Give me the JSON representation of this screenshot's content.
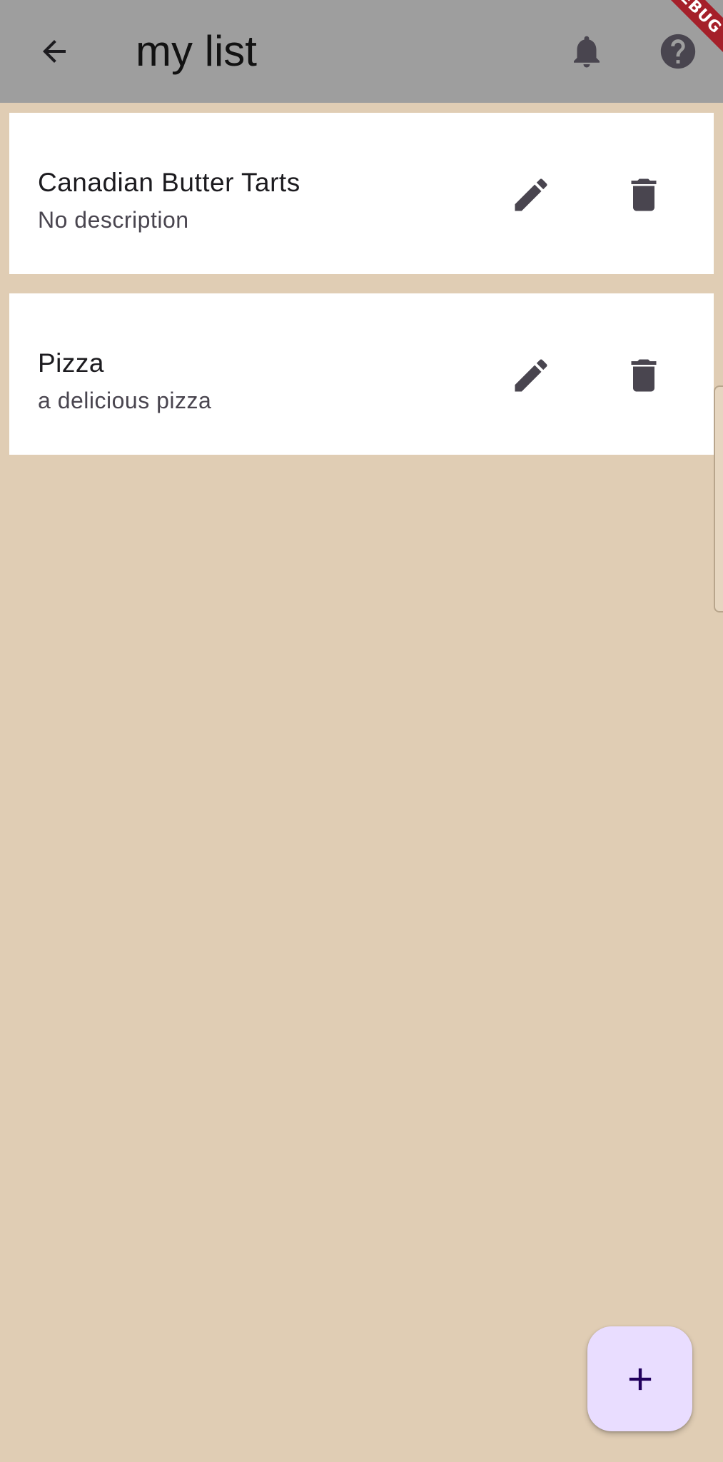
{
  "app_bar": {
    "title": "my list",
    "back_icon": "arrow-back-icon",
    "notification_icon": "bell-icon",
    "help_icon": "help-circle-icon",
    "background_color": "#9e9e9e"
  },
  "debug_banner": {
    "label": "DEBUG",
    "color": "#a5202a"
  },
  "items": [
    {
      "title": "Canadian Butter Tarts",
      "description": "No description",
      "edit_icon": "pencil-icon",
      "delete_icon": "trash-icon"
    },
    {
      "title": "Pizza",
      "description": "a delicious pizza",
      "edit_icon": "pencil-icon",
      "delete_icon": "trash-icon"
    }
  ],
  "fab": {
    "icon": "plus-icon",
    "background_color": "#e9ddff",
    "icon_color": "#21005d"
  },
  "colors": {
    "page_background": "#e0cdb4",
    "card_background": "#ffffff",
    "icon_color": "#49454f"
  }
}
